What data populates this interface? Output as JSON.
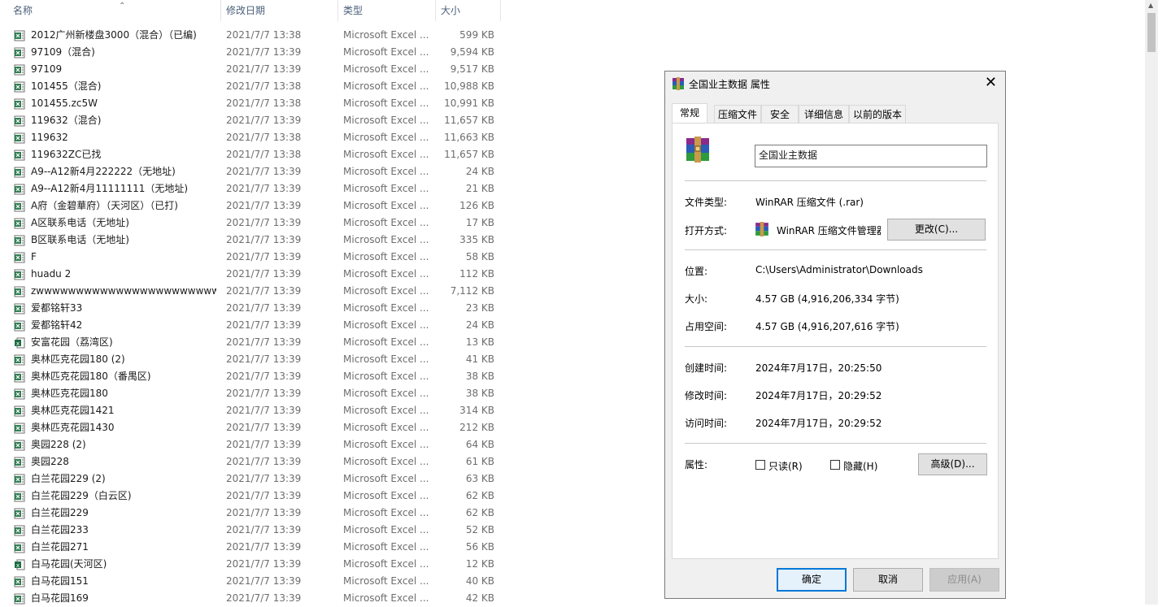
{
  "columns": {
    "name": "名称",
    "date": "修改日期",
    "type": "类型",
    "size": "大小"
  },
  "sort_arrow": "⌃",
  "files": [
    {
      "name": "2012广州新楼盘3000（混合）（已编)",
      "date": "2021/7/7 13:38",
      "type": "Microsoft Excel ...",
      "size": "599 KB",
      "icon": "excel-icon"
    },
    {
      "name": "97109（混合)",
      "date": "2021/7/7 13:39",
      "type": "Microsoft Excel ...",
      "size": "9,594 KB",
      "icon": "excel-icon"
    },
    {
      "name": "97109",
      "date": "2021/7/7 13:39",
      "type": "Microsoft Excel ...",
      "size": "9,517 KB",
      "icon": "excel-icon"
    },
    {
      "name": "101455（混合)",
      "date": "2021/7/7 13:38",
      "type": "Microsoft Excel ...",
      "size": "10,988 KB",
      "icon": "excel-icon"
    },
    {
      "name": "101455.zc5W",
      "date": "2021/7/7 13:38",
      "type": "Microsoft Excel ...",
      "size": "10,991 KB",
      "icon": "excel-icon"
    },
    {
      "name": "119632（混合)",
      "date": "2021/7/7 13:39",
      "type": "Microsoft Excel ...",
      "size": "11,657 KB",
      "icon": "excel-icon"
    },
    {
      "name": "119632",
      "date": "2021/7/7 13:38",
      "type": "Microsoft Excel ...",
      "size": "11,663 KB",
      "icon": "excel-icon"
    },
    {
      "name": "119632ZC已找",
      "date": "2021/7/7 13:38",
      "type": "Microsoft Excel ...",
      "size": "11,657 KB",
      "icon": "excel-icon"
    },
    {
      "name": "A9--A12新4月222222（无地址)",
      "date": "2021/7/7 13:39",
      "type": "Microsoft Excel ...",
      "size": "24 KB",
      "icon": "excel-icon"
    },
    {
      "name": "A9--A12新4月11111111（无地址)",
      "date": "2021/7/7 13:39",
      "type": "Microsoft Excel ...",
      "size": "21 KB",
      "icon": "excel-icon"
    },
    {
      "name": "A府（金碧華府）（天河区）（已打)",
      "date": "2021/7/7 13:39",
      "type": "Microsoft Excel ...",
      "size": "126 KB",
      "icon": "excel-icon"
    },
    {
      "name": "A区联系电话（无地址)",
      "date": "2021/7/7 13:39",
      "type": "Microsoft Excel ...",
      "size": "17 KB",
      "icon": "excel-icon"
    },
    {
      "name": "B区联系电话（无地址)",
      "date": "2021/7/7 13:39",
      "type": "Microsoft Excel ...",
      "size": "335 KB",
      "icon": "excel-icon"
    },
    {
      "name": "F",
      "date": "2021/7/7 13:39",
      "type": "Microsoft Excel ...",
      "size": "58 KB",
      "icon": "excel-icon"
    },
    {
      "name": "huadu 2",
      "date": "2021/7/7 13:39",
      "type": "Microsoft Excel ...",
      "size": "112 KB",
      "icon": "excel-icon"
    },
    {
      "name": "zwwwwwwwwwwwwwwwwwwwwwwwwwwww",
      "date": "2021/7/7 13:39",
      "type": "Microsoft Excel ...",
      "size": "7,112 KB",
      "icon": "excel-icon"
    },
    {
      "name": "爱都铭轩33",
      "date": "2021/7/7 13:39",
      "type": "Microsoft Excel ...",
      "size": "23 KB",
      "icon": "excel-icon"
    },
    {
      "name": "爱都铭轩42",
      "date": "2021/7/7 13:39",
      "type": "Microsoft Excel ...",
      "size": "24 KB",
      "icon": "excel-icon"
    },
    {
      "name": "安富花园（荔湾区)",
      "date": "2021/7/7 13:39",
      "type": "Microsoft Excel ...",
      "size": "13 KB",
      "icon": "excel-x-icon"
    },
    {
      "name": "奥林匹克花园180 (2)",
      "date": "2021/7/7 13:39",
      "type": "Microsoft Excel ...",
      "size": "41 KB",
      "icon": "excel-icon"
    },
    {
      "name": "奥林匹克花园180（番禺区)",
      "date": "2021/7/7 13:39",
      "type": "Microsoft Excel ...",
      "size": "38 KB",
      "icon": "excel-icon"
    },
    {
      "name": "奥林匹克花园180",
      "date": "2021/7/7 13:39",
      "type": "Microsoft Excel ...",
      "size": "38 KB",
      "icon": "excel-icon"
    },
    {
      "name": "奥林匹克花园1421",
      "date": "2021/7/7 13:39",
      "type": "Microsoft Excel ...",
      "size": "314 KB",
      "icon": "excel-icon"
    },
    {
      "name": "奥林匹克花园1430",
      "date": "2021/7/7 13:39",
      "type": "Microsoft Excel ...",
      "size": "212 KB",
      "icon": "excel-icon"
    },
    {
      "name": "奥园228 (2)",
      "date": "2021/7/7 13:39",
      "type": "Microsoft Excel ...",
      "size": "64 KB",
      "icon": "excel-icon"
    },
    {
      "name": "奥园228",
      "date": "2021/7/7 13:39",
      "type": "Microsoft Excel ...",
      "size": "61 KB",
      "icon": "excel-icon"
    },
    {
      "name": "白兰花园229 (2)",
      "date": "2021/7/7 13:39",
      "type": "Microsoft Excel ...",
      "size": "63 KB",
      "icon": "excel-icon"
    },
    {
      "name": "白兰花园229（白云区)",
      "date": "2021/7/7 13:39",
      "type": "Microsoft Excel ...",
      "size": "62 KB",
      "icon": "excel-icon"
    },
    {
      "name": "白兰花园229",
      "date": "2021/7/7 13:39",
      "type": "Microsoft Excel ...",
      "size": "62 KB",
      "icon": "excel-icon"
    },
    {
      "name": "白兰花园233",
      "date": "2021/7/7 13:39",
      "type": "Microsoft Excel ...",
      "size": "52 KB",
      "icon": "excel-icon"
    },
    {
      "name": "白兰花园271",
      "date": "2021/7/7 13:39",
      "type": "Microsoft Excel ...",
      "size": "56 KB",
      "icon": "excel-icon"
    },
    {
      "name": "白马花园(天河区)",
      "date": "2021/7/7 13:39",
      "type": "Microsoft Excel ...",
      "size": "12 KB",
      "icon": "excel-x-icon"
    },
    {
      "name": "白马花园151",
      "date": "2021/7/7 13:39",
      "type": "Microsoft Excel ...",
      "size": "40 KB",
      "icon": "excel-icon"
    },
    {
      "name": "白马花园169",
      "date": "2021/7/7 13:39",
      "type": "Microsoft Excel ...",
      "size": "42 KB",
      "icon": "excel-icon"
    }
  ],
  "dialog": {
    "title": "全国业主数据 属性",
    "close_glyph": "✕",
    "tabs": [
      "常规",
      "压缩文件",
      "安全",
      "详细信息",
      "以前的版本"
    ],
    "active_tab": 0,
    "file_name": "全国业主数据",
    "file_type_label": "文件类型:",
    "file_type_value": "WinRAR 压缩文件 (.rar)",
    "opens_with_label": "打开方式:",
    "opens_with_value": "WinRAR 压缩文件管理器",
    "change_button": "更改(C)...",
    "location_label": "位置:",
    "location_value": "C:\\Users\\Administrator\\Downloads",
    "size_label": "大小:",
    "size_value": "4.57 GB (4,916,206,334 字节)",
    "disk_size_label": "占用空间:",
    "disk_size_value": "4.57 GB (4,916,207,616 字节)",
    "created_label": "创建时间:",
    "created_value": "2024年7月17日，20:25:50",
    "modified_label": "修改时间:",
    "modified_value": "2024年7月17日，20:29:52",
    "accessed_label": "访问时间:",
    "accessed_value": "2024年7月17日，20:29:52",
    "attributes_label": "属性:",
    "readonly_label": "只读(R)",
    "hidden_label": "隐藏(H)",
    "advanced_button": "高级(D)...",
    "ok_button": "确定",
    "cancel_button": "取消",
    "apply_button": "应用(A)"
  }
}
